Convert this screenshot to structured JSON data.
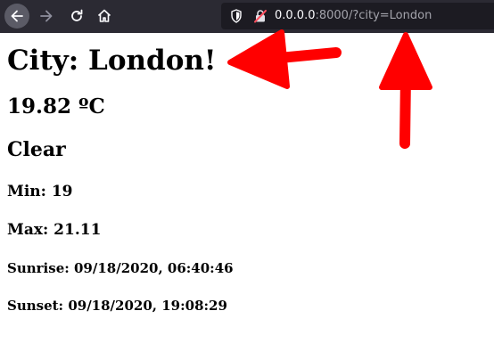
{
  "browser": {
    "toolbar": {
      "back_icon": "arrow-left-icon",
      "forward_icon": "arrow-right-icon",
      "reload_icon": "reload-icon",
      "home_icon": "home-icon"
    },
    "url_bar": {
      "host": "0.0.0.0",
      "rest": ":8000/?city=London",
      "shield_icon": "shield-icon",
      "lock_icon": "insecure-lock-icon"
    },
    "colors": {
      "toolbar_bg": "#2b2a33",
      "url_bg": "#1c1b22",
      "arrow_red": "#ff0000"
    }
  },
  "page": {
    "city_heading": "City: London!",
    "temperature": "19.82 ºC",
    "condition": "Clear",
    "min": "Min: 19",
    "max": "Max: 21.11",
    "sunrise": "Sunrise: 09/18/2020, 06:40:46",
    "sunset": "Sunset: 09/18/2020, 19:08:29"
  }
}
